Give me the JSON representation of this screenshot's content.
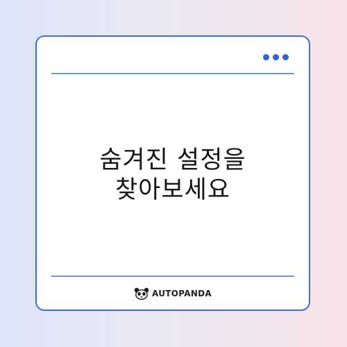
{
  "card": {
    "headline_line1": "숨겨진 설정을",
    "headline_line2": "찾아보세요"
  },
  "window_controls": {
    "icon": "more-dots-icon"
  },
  "brand": {
    "logo_icon": "panda-icon",
    "name": "AUTOPANDA"
  },
  "colors": {
    "accent": "#3b6fd8",
    "text": "#161616"
  }
}
